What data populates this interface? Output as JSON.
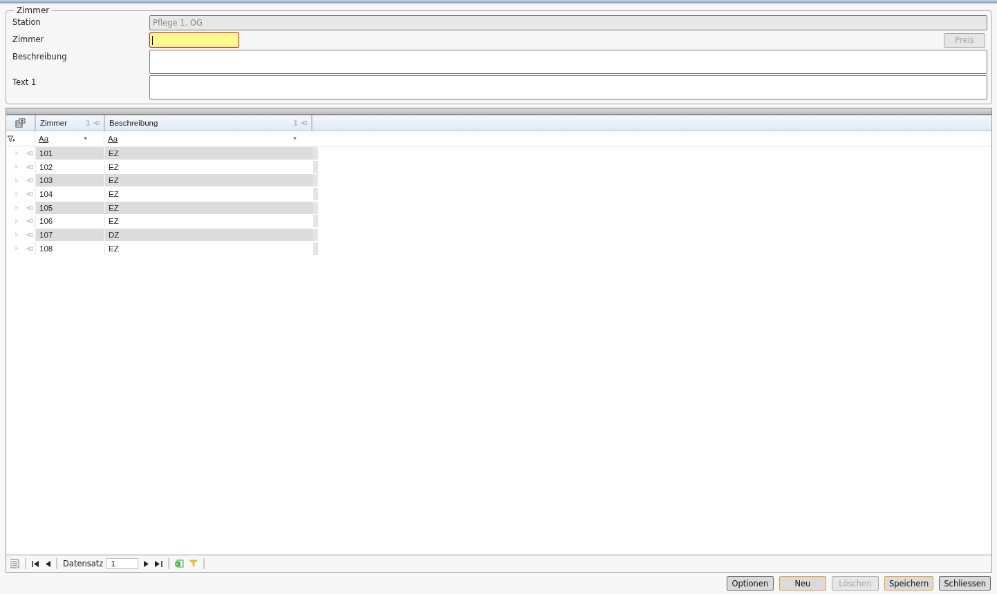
{
  "group": {
    "title": "Zimmer",
    "fields": [
      {
        "label": "Station",
        "value": "Pflege 1. OG",
        "kind": "readonly"
      },
      {
        "label": "Zimmer",
        "kind": "required"
      },
      {
        "label": "Beschreibung",
        "kind": "multiline"
      },
      {
        "label": "Text 1",
        "kind": "multiline"
      }
    ],
    "price_button": {
      "label": "Preis",
      "disabled": true
    }
  },
  "table": {
    "columns": [
      "Zimmer",
      "Beschreibung"
    ],
    "filter_hints": [
      "Aa",
      "Aa"
    ],
    "rows": [
      [
        "101",
        "EZ"
      ],
      [
        "102",
        "EZ"
      ],
      [
        "103",
        "EZ"
      ],
      [
        "104",
        "EZ"
      ],
      [
        "105",
        "EZ"
      ],
      [
        "106",
        "EZ"
      ],
      [
        "107",
        "DZ"
      ],
      [
        "108",
        "EZ"
      ]
    ]
  },
  "navigator": {
    "label": "Datensatz",
    "value": "1"
  },
  "buttons": [
    {
      "label": "Optionen",
      "disabled": false,
      "highlighted": false
    },
    {
      "label": "Neu",
      "disabled": false,
      "highlighted": true
    },
    {
      "label": "Löschen",
      "disabled": true,
      "highlighted": false
    },
    {
      "label": "Speichern",
      "disabled": false,
      "highlighted": true
    },
    {
      "label": "Schliessen",
      "disabled": false,
      "highlighted": false
    }
  ]
}
